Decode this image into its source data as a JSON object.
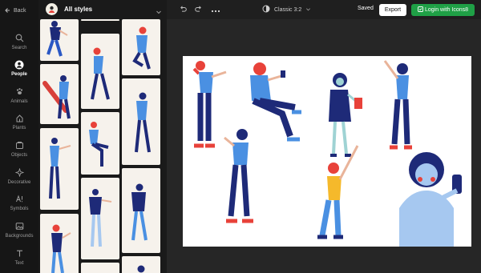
{
  "nav": {
    "back_label": "Back"
  },
  "sidebar": {
    "items": [
      {
        "label": "Search",
        "icon": "search-icon"
      },
      {
        "label": "People",
        "icon": "person-icon",
        "active": true
      },
      {
        "label": "Animals",
        "icon": "paw-icon"
      },
      {
        "label": "Plants",
        "icon": "plant-icon"
      },
      {
        "label": "Objects",
        "icon": "objects-icon"
      },
      {
        "label": "Decorative",
        "icon": "sparkle-icon"
      },
      {
        "label": "Symbols",
        "icon": "symbols-icon"
      },
      {
        "label": "Backgrounds",
        "icon": "image-icon"
      },
      {
        "label": "Text",
        "icon": "text-icon"
      }
    ]
  },
  "panel": {
    "style_label": "All styles"
  },
  "toolbar": {
    "style_label": "Classic 3:2",
    "saved_label": "Saved",
    "export_label": "Export",
    "login_label": "Login with Icons8"
  },
  "colors": {
    "accent_green": "#1fa046",
    "figure_blue": "#4a90e2",
    "figure_navy": "#1e2a78",
    "figure_red": "#e8423a"
  }
}
